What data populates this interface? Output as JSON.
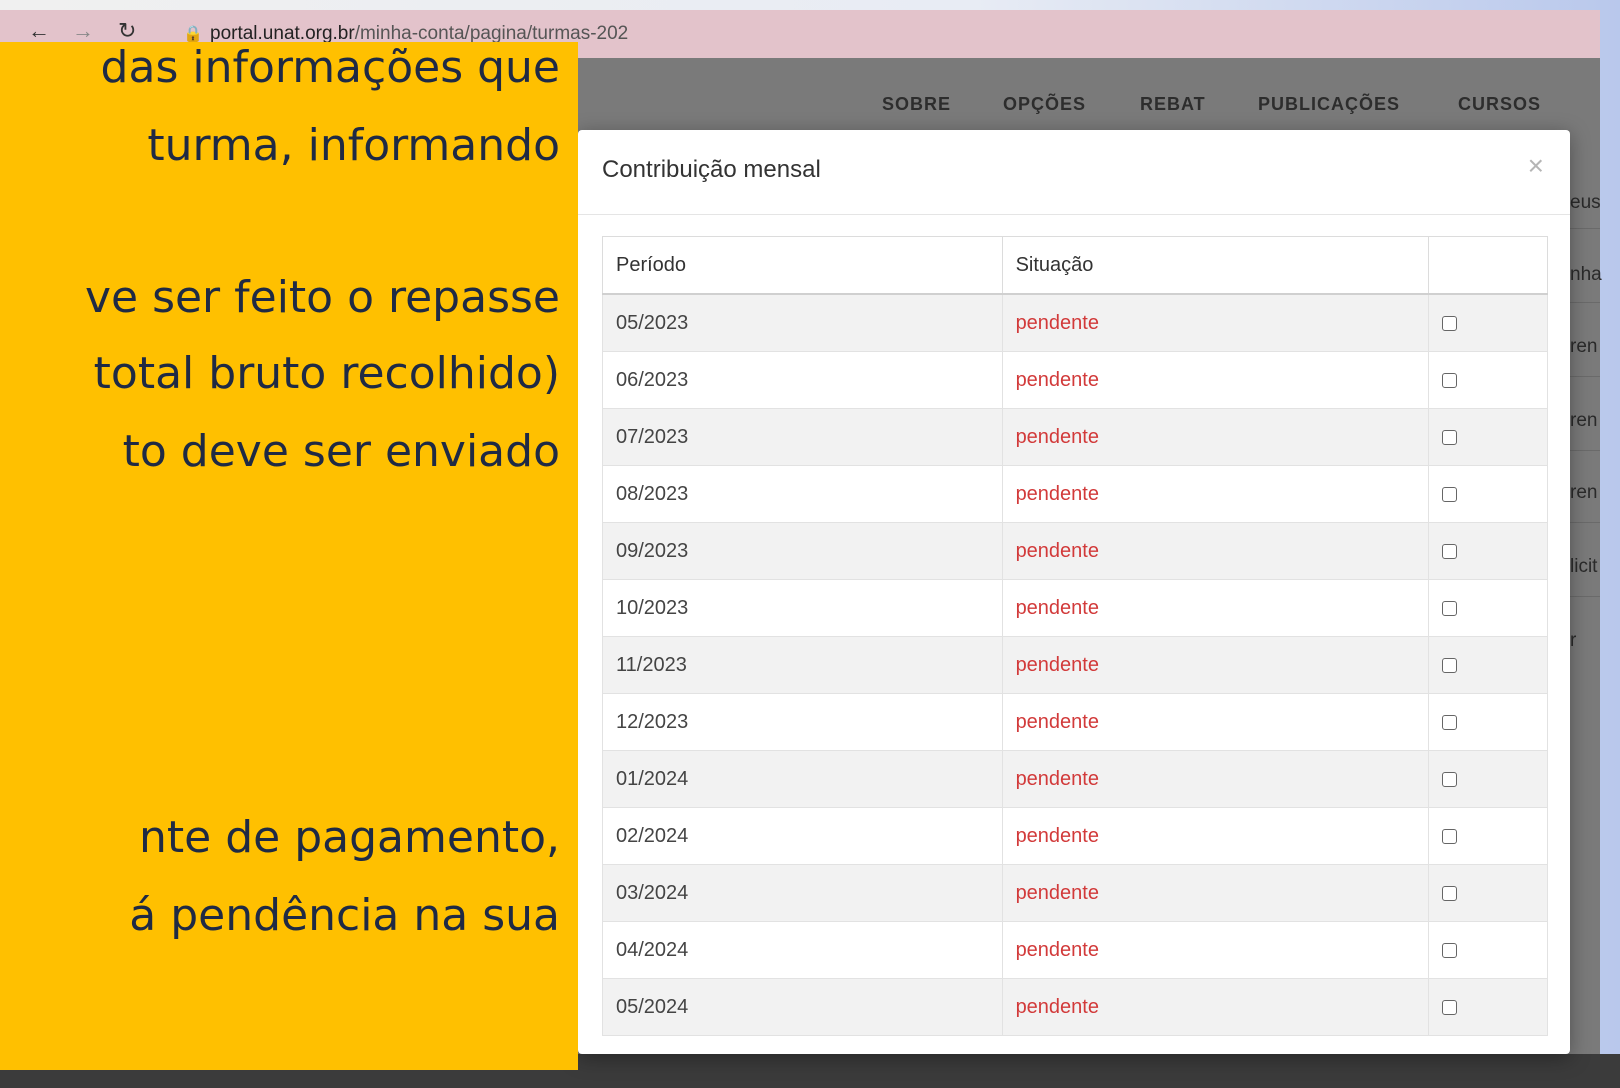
{
  "browser": {
    "url_host": "portal.unat.org.br",
    "url_path": "/minha-conta/pagina/turmas-202"
  },
  "site_nav": [
    "SOBRE",
    "OPÇÕES",
    "REBAT",
    "PUBLICAÇÕES",
    "CURSOS"
  ],
  "side_fragments": [
    "eus",
    "nha",
    "ren",
    "ren",
    "ren",
    "licit",
    "r"
  ],
  "modal": {
    "title": "Contribuição mensal",
    "close_label": "×",
    "columns": [
      "Período",
      "Situação",
      ""
    ],
    "rows": [
      {
        "period": "05/2023",
        "status": "pendente"
      },
      {
        "period": "06/2023",
        "status": "pendente"
      },
      {
        "period": "07/2023",
        "status": "pendente"
      },
      {
        "period": "08/2023",
        "status": "pendente"
      },
      {
        "period": "09/2023",
        "status": "pendente"
      },
      {
        "period": "10/2023",
        "status": "pendente"
      },
      {
        "period": "11/2023",
        "status": "pendente"
      },
      {
        "period": "12/2023",
        "status": "pendente"
      },
      {
        "period": "01/2024",
        "status": "pendente"
      },
      {
        "period": "02/2024",
        "status": "pendente"
      },
      {
        "period": "03/2024",
        "status": "pendente"
      },
      {
        "period": "04/2024",
        "status": "pendente"
      },
      {
        "period": "05/2024",
        "status": "pendente"
      }
    ]
  },
  "annotation": {
    "lines": [
      "das informações que",
      "turma, informando",
      "ve ser feito o repasse",
      "total bruto recolhido)",
      "to deve ser enviado",
      "nte de pagamento,",
      "á pendência na sua"
    ]
  },
  "colors": {
    "annotation_bg": "#ffc000",
    "status_pending": "#d23a3a",
    "overlay": "#7a7a7a"
  }
}
